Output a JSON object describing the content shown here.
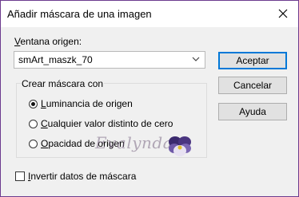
{
  "window": {
    "title": "Añadir máscara de una imagen"
  },
  "source": {
    "label_prefix": "",
    "label_underlined": "V",
    "label_rest": "entana origen:",
    "selected": "smArt_maszk_70"
  },
  "buttons": {
    "accept": "Aceptar",
    "cancel": "Cancelar",
    "help": "Ayuda"
  },
  "group": {
    "legend": "Crear máscara con",
    "options": [
      {
        "u": "L",
        "rest": "uminancia de origen",
        "selected": true
      },
      {
        "u": "C",
        "rest": "ualquier valor distinto de cero",
        "selected": false
      },
      {
        "u": "O",
        "rest": "pacidad de origen",
        "selected": false
      }
    ]
  },
  "invert": {
    "u": "I",
    "rest": "nvertir datos de máscara",
    "checked": false
  },
  "watermark": {
    "text": "Evalynda"
  },
  "icons": {
    "close": "close-icon",
    "dropdown": "chevron-down-icon"
  },
  "colors": {
    "window_border": "#6c3b8e",
    "default_button_border": "#0078d7"
  }
}
